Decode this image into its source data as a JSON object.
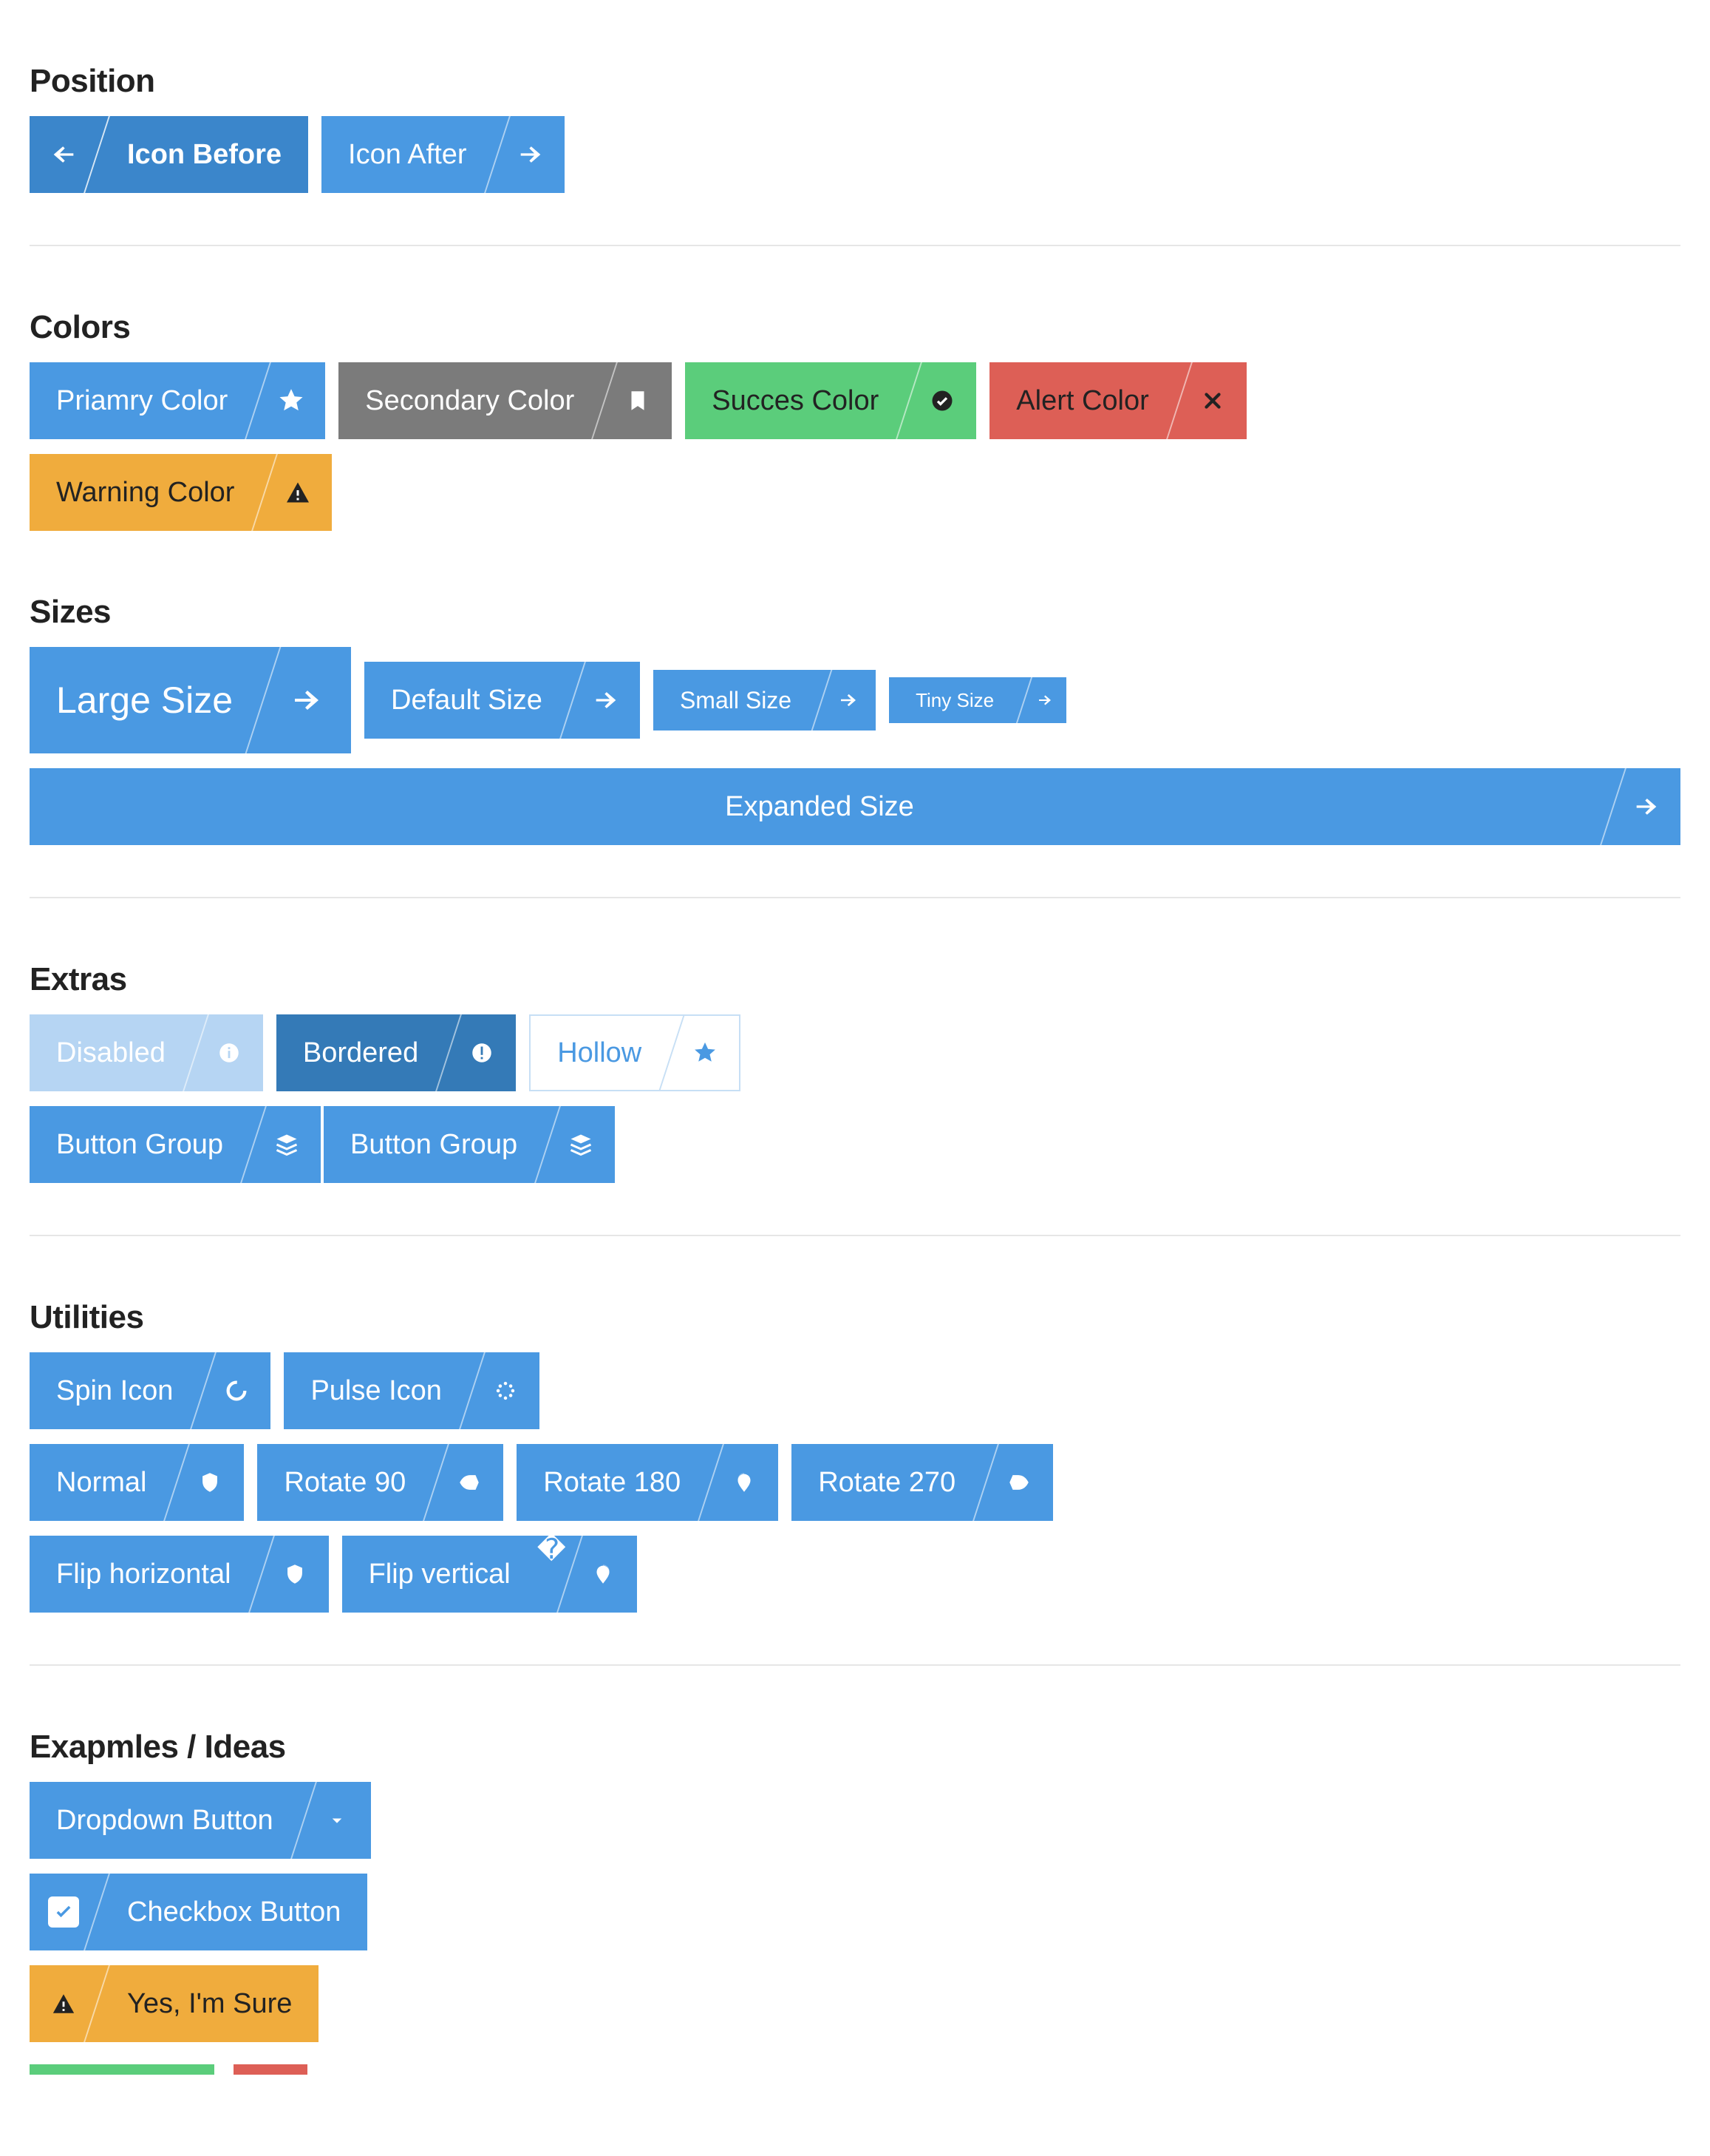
{
  "sections": {
    "position": {
      "title": "Position",
      "buttons": {
        "icon_before": "Icon Before",
        "icon_after": "Icon After"
      }
    },
    "colors": {
      "title": "Colors",
      "buttons": {
        "primary": "Priamry Color",
        "secondary": "Secondary Color",
        "success": "Succes Color",
        "alert": "Alert Color",
        "warning": "Warning Color"
      }
    },
    "sizes": {
      "title": "Sizes",
      "buttons": {
        "large": "Large Size",
        "default": "Default Size",
        "small": "Small Size",
        "tiny": "Tiny Size",
        "expanded": "Expanded Size"
      }
    },
    "extras": {
      "title": "Extras",
      "buttons": {
        "disabled": "Disabled",
        "bordered": "Bordered",
        "hollow": "Hollow",
        "group1": "Button Group",
        "group2": "Button Group"
      }
    },
    "utilities": {
      "title": "Utilities",
      "buttons": {
        "spin": "Spin Icon",
        "pulse": "Pulse Icon",
        "normal": "Normal",
        "rotate90": "Rotate 90",
        "rotate180": "Rotate 180",
        "rotate270": "Rotate 270",
        "flip_h": "Flip horizontal",
        "flip_v": "Flip vertical"
      }
    },
    "examples": {
      "title": "Exapmles / Ideas",
      "buttons": {
        "dropdown": "Dropdown Button",
        "checkbox": "Checkbox Button",
        "confirm": "Yes, I'm Sure"
      }
    }
  },
  "colors": {
    "primary": "#4a99e2",
    "primary_active": "#3b86cb",
    "secondary": "#7b7b7b",
    "success": "#5bcd7b",
    "alert": "#dd5f56",
    "warning": "#f0ac3d"
  }
}
